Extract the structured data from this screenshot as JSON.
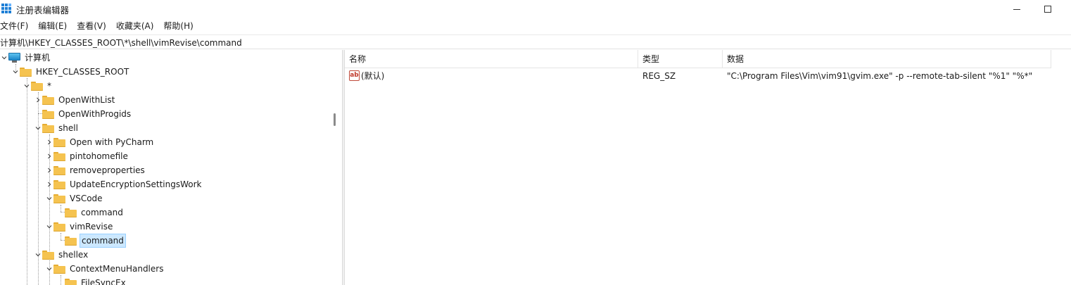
{
  "window": {
    "title": "注册表编辑器",
    "accent": "#1e7fd6"
  },
  "menu": [
    "文件(F)",
    "编辑(E)",
    "查看(V)",
    "收藏夹(A)",
    "帮助(H)"
  ],
  "address": "计算机\\HKEY_CLASSES_ROOT\\*\\shell\\vimRevise\\command",
  "tree": {
    "root": "计算机",
    "hkcr": "HKEY_CLASSES_ROOT",
    "star": "*",
    "openwithlist": "OpenWithList",
    "openwithprogids": "OpenWithProgids",
    "shell": "shell",
    "openwithpycharm": "Open with PyCharm",
    "pintohomefile": "pintohomefile",
    "removeproperties": "removeproperties",
    "updateencryption": "UpdateEncryptionSettingsWork",
    "vscode": "VSCode",
    "vscode_command": "command",
    "vimrevise": "vimRevise",
    "vimrevise_command": "command",
    "shellex": "shellex",
    "contextmenuhandlers": "ContextMenuHandlers",
    "filesyncex": "FileSyncEx"
  },
  "list": {
    "columns": [
      "名称",
      "类型",
      "数据"
    ],
    "rows": [
      {
        "name": "(默认)",
        "type": "REG_SZ",
        "data": "\"C:\\Program Files\\Vim\\vim91\\gvim.exe\" -p --remote-tab-silent \"%1\" \"%*\"",
        "icon": "string-value-icon"
      }
    ]
  }
}
